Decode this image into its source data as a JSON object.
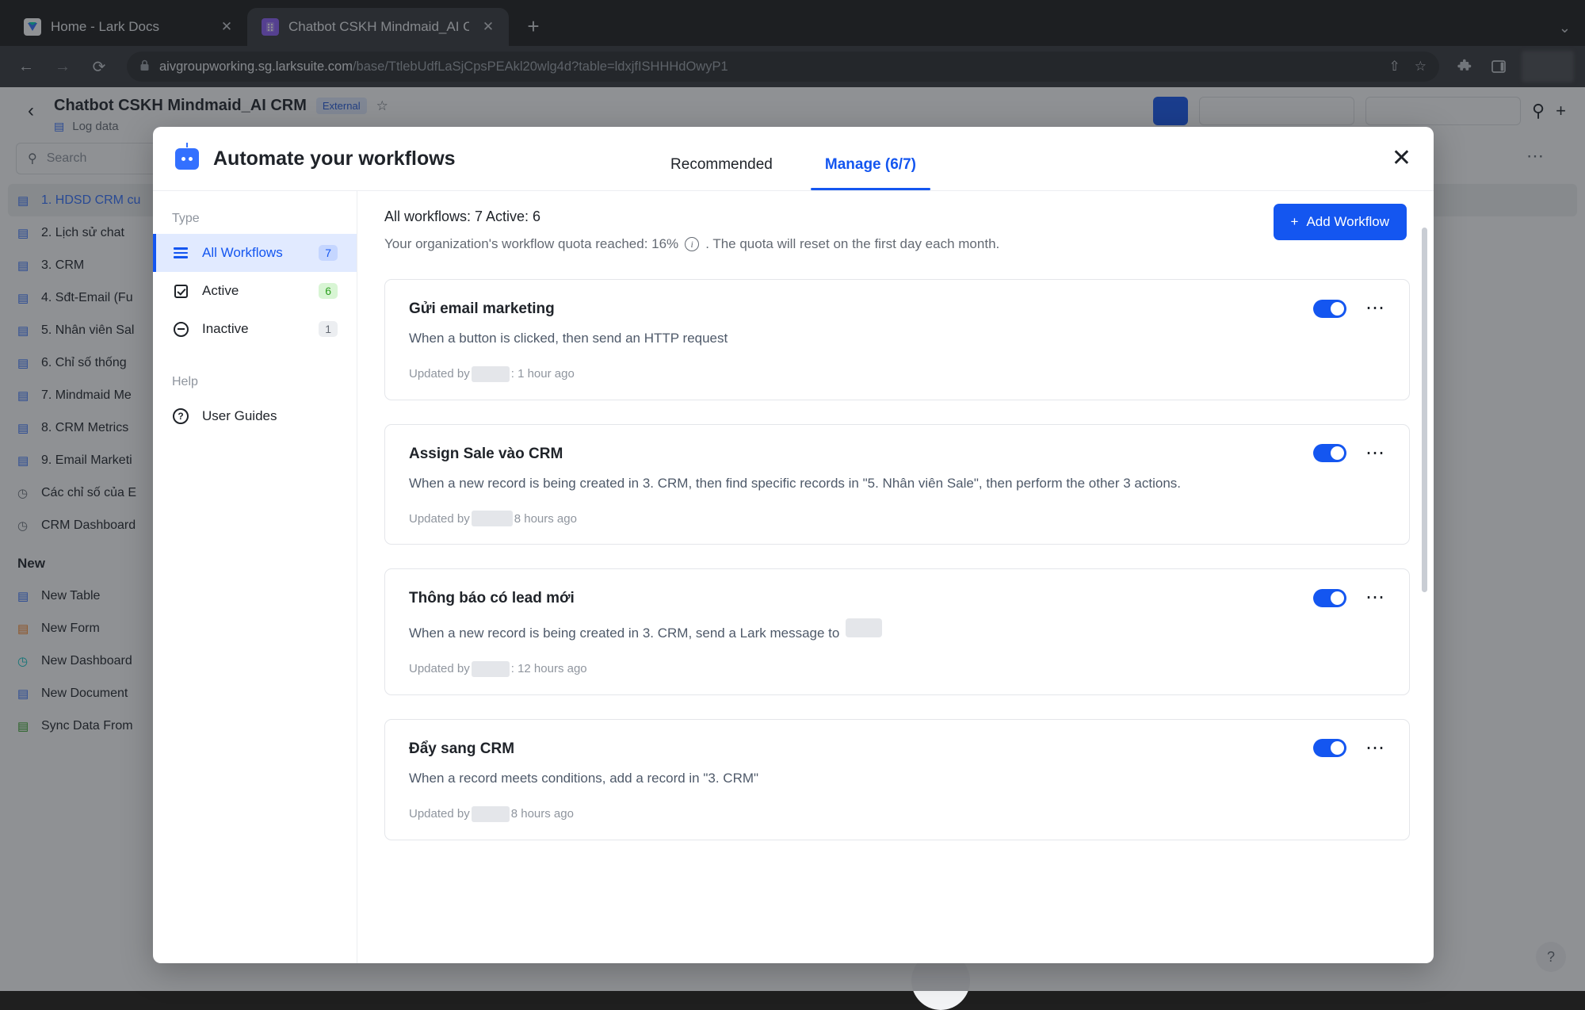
{
  "browser": {
    "tabs": [
      {
        "title": "Home - Lark Docs",
        "favicon": "lark-docs-icon",
        "active": false
      },
      {
        "title": "Chatbot CSKH Mindmaid_AI CR",
        "favicon": "lark-base-icon",
        "active": true
      }
    ],
    "new_tab_label": "+",
    "tabstrip_menu": "⌄",
    "back_icon": "←",
    "forward_icon": "→",
    "reload_icon": "⟳",
    "lock_icon": "🔒",
    "url_host": "aivgroupworking.sg.larksuite.com",
    "url_path": "/base/TtlebUdfLaSjCpsPEAkl20wlg4d?table=ldxjfISHHHdOwyP1",
    "share_icon": "⇧",
    "bookmark_icon": "☆",
    "extensions_icon": "🧩",
    "sidepanel_icon": "◨"
  },
  "page": {
    "back_icon": "‹",
    "doc_title": "Chatbot CSKH Mindmaid_AI CRM",
    "badge": "External",
    "star_icon": "☆",
    "table_icon": "▤",
    "subtitle": "Log data",
    "primary_button": "",
    "more_icon": "⋯",
    "search_icon": "⚲",
    "plus_icon": "+",
    "search_placeholder": "Search",
    "tables": [
      {
        "label": "1. HDSD CRM cu",
        "icon": "table-icon",
        "selected": true
      },
      {
        "label": "2. Lịch sử chat",
        "icon": "table-icon",
        "selected": false
      },
      {
        "label": "3. CRM",
        "icon": "table-icon",
        "selected": false
      },
      {
        "label": "4. Sđt-Email (Fu",
        "icon": "table-icon",
        "selected": false
      },
      {
        "label": "5. Nhân viên Sal",
        "icon": "table-icon",
        "selected": false
      },
      {
        "label": "6. Chỉ số thống",
        "icon": "table-icon",
        "selected": false
      },
      {
        "label": "7. Mindmaid Me",
        "icon": "table-icon",
        "selected": false
      },
      {
        "label": "8. CRM Metrics",
        "icon": "table-icon",
        "selected": false
      },
      {
        "label": "9. Email Marketi",
        "icon": "table-icon",
        "selected": false
      },
      {
        "label": "Các chỉ số của E",
        "icon": "clock-icon",
        "selected": false
      },
      {
        "label": "CRM Dashboard",
        "icon": "clock-icon",
        "selected": false
      }
    ],
    "new_section_title": "New",
    "new_items": [
      {
        "label": "New Table",
        "icon": "table-icon"
      },
      {
        "label": "New Form",
        "icon": "form-icon"
      },
      {
        "label": "New Dashboard",
        "icon": "dashboard-icon"
      },
      {
        "label": "New Document",
        "icon": "document-icon"
      },
      {
        "label": "Sync Data From",
        "icon": "sync-icon"
      }
    ],
    "help_icon": "?"
  },
  "modal": {
    "title": "Automate your workflows",
    "brand_icon": "robot-icon",
    "close_icon": "✕",
    "tabs": [
      {
        "label": "Recommended",
        "active": false
      },
      {
        "label": "Manage (6/7)",
        "active": true
      }
    ],
    "sidebar": {
      "type_label": "Type",
      "items": [
        {
          "label": "All Workflows",
          "count": "7",
          "icon": "list-icon",
          "badge_color": "blue",
          "active": true
        },
        {
          "label": "Active",
          "count": "6",
          "icon": "checkbox-icon",
          "badge_color": "green",
          "active": false
        },
        {
          "label": "Inactive",
          "count": "1",
          "icon": "circle-minus-icon",
          "badge_color": "gray",
          "active": false
        }
      ],
      "help_label": "Help",
      "help_items": [
        {
          "label": "User Guides",
          "icon": "question-circle-icon"
        }
      ]
    },
    "summary": "All workflows: 7 Active: 6",
    "quota_prefix": "Your organization's workflow quota reached: 16%",
    "quota_info_icon": "i",
    "quota_suffix": ". The quota will reset on the first day each month.",
    "add_button": "Add Workflow",
    "add_button_icon": "+",
    "more_icon": "⋯",
    "workflows": [
      {
        "name": "Gửi email marketing",
        "description": "When a button is clicked, then send an HTTP request",
        "updated_prefix": "Updated by",
        "updated_suffix": ": 1 hour ago",
        "enabled": true,
        "has_trailing_chip": false
      },
      {
        "name": "Assign Sale vào CRM",
        "description": "When a new record is being created in 3. CRM, then find specific records in \"5. Nhân viên Sale\", then perform the other 3 actions.",
        "updated_prefix": "Updated by",
        "updated_suffix": " 8 hours ago",
        "enabled": true,
        "has_trailing_chip": false
      },
      {
        "name": "Thông báo có lead mới",
        "description": "When a new record is being created in 3. CRM, send a Lark message to",
        "updated_prefix": "Updated by",
        "updated_suffix": ": 12 hours ago",
        "enabled": true,
        "has_trailing_chip": true
      },
      {
        "name": "Đẩy sang CRM",
        "description": "When a record meets conditions, add a record in \"3. CRM\"",
        "updated_prefix": "Updated by",
        "updated_suffix": " 8 hours ago",
        "enabled": true,
        "has_trailing_chip": false
      }
    ]
  },
  "colors": {
    "accent": "#1456f0",
    "link": "#3370ff",
    "active_badge": "#2ea121",
    "modal_bg": "#ffffff",
    "overlay": "rgba(31,35,41,0.5)"
  }
}
